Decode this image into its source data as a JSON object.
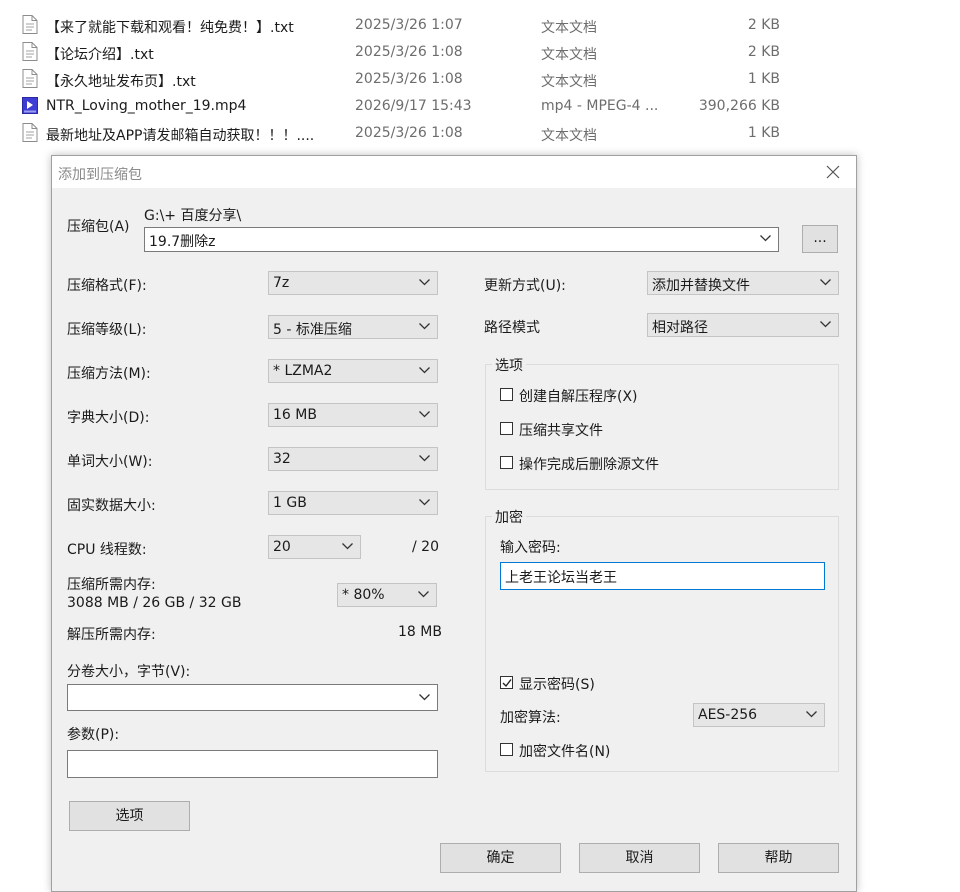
{
  "files": [
    {
      "name": "【来了就能下载和观看！纯免费！】.txt",
      "date": "2025/3/26 1:07",
      "type": "文本文档",
      "size": "2 KB",
      "icon": "text-file-icon"
    },
    {
      "name": "【论坛介绍】.txt",
      "date": "2025/3/26 1:08",
      "type": "文本文档",
      "size": "2 KB",
      "icon": "text-file-icon"
    },
    {
      "name": "【永久地址发布页】.txt",
      "date": "2025/3/26 1:08",
      "type": "文本文档",
      "size": "1 KB",
      "icon": "text-file-icon"
    },
    {
      "name": "NTR_Loving_mother_19.mp4",
      "date": "2026/9/17 15:43",
      "type": "mp4 - MPEG-4 ...",
      "size": "390,266 KB",
      "icon": "video-file-icon"
    },
    {
      "name": "最新地址及APP请发邮箱自动获取！！！....",
      "date": "2025/3/26 1:08",
      "type": "文本文档",
      "size": "1 KB",
      "icon": "text-file-icon"
    }
  ],
  "dialog": {
    "title": "添加到压缩包",
    "archive_label": "压缩包(A)",
    "archive_path": "G:\\+ 百度分享\\",
    "archive_name": "19.7删除z",
    "browse_label": "...",
    "format_label": "压缩格式(F):",
    "format_value": "7z",
    "level_label": "压缩等级(L):",
    "level_value": "5 - 标准压缩",
    "method_label": "压缩方法(M):",
    "method_value": "* LZMA2",
    "dict_label": "字典大小(D):",
    "dict_value": "16 MB",
    "word_label": "单词大小(W):",
    "word_value": "32",
    "solid_label": "固实数据大小:",
    "solid_value": "1 GB",
    "cpu_label": "CPU 线程数:",
    "cpu_value": "20",
    "cpu_max": "/ 20",
    "mem_label": "压缩所需内存:",
    "mem_value": "3088 MB / 26 GB / 32 GB",
    "mem_pct": "* 80%",
    "unmem_label": "解压所需内存:",
    "unmem_value": "18 MB",
    "volume_label": "分卷大小，字节(V):",
    "volume_value": "",
    "params_label": "参数(P):",
    "params_value": "",
    "options_button": "选项",
    "update_label": "更新方式(U):",
    "update_value": "添加并替换文件",
    "path_label": "路径模式",
    "path_value": "相对路径",
    "options_group": "选项",
    "opt_sfx": "创建自解压程序(X)",
    "opt_shared": "压缩共享文件",
    "opt_delete": "操作完成后删除源文件",
    "enc_group": "加密",
    "pwd_label": "输入密码:",
    "pwd_value": "上老王论坛当老王",
    "show_pwd": "显示密码(S)",
    "enc_method_label": "加密算法:",
    "enc_method_value": "AES-256",
    "enc_names": "加密文件名(N)",
    "ok_button": "确定",
    "cancel_button": "取消",
    "help_button": "帮助"
  }
}
